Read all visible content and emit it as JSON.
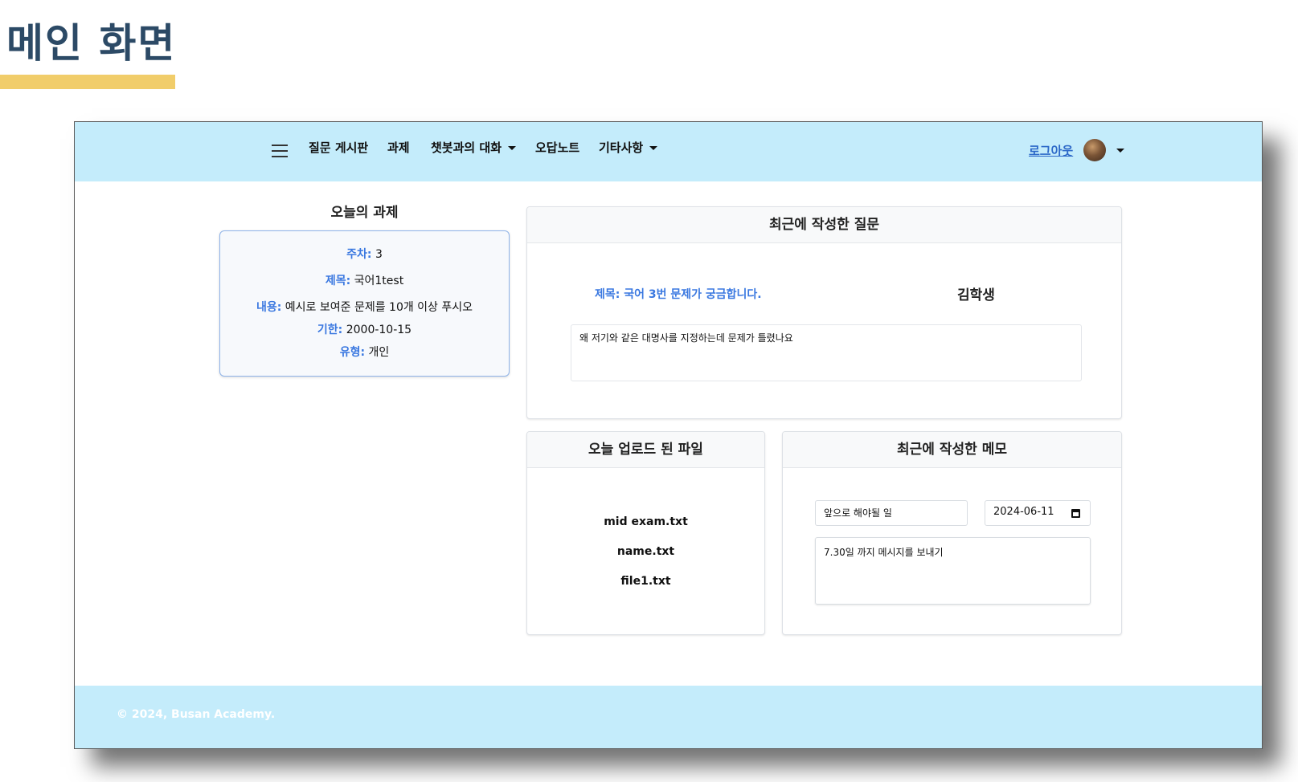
{
  "slide": {
    "title": "메인 화면"
  },
  "navbar": {
    "items": [
      {
        "label": "질문 게시판"
      },
      {
        "label": "과제"
      },
      {
        "label": "챗봇과의 대화"
      },
      {
        "label": "오답노트"
      },
      {
        "label": "기타사항"
      }
    ],
    "logout_label": "로그아웃"
  },
  "today_assignment": {
    "heading": "오늘의 과제",
    "week_label": "주차:",
    "week_value": "3",
    "title_label": "제목:",
    "title_value": "국어1test",
    "content_label": "내용:",
    "content_value": "예시로 보여준 문제를 10개 이상 푸시오",
    "deadline_label": "기한:",
    "deadline_value": "2000-10-15",
    "type_label": "유형:",
    "type_value": "개인"
  },
  "recent_question": {
    "heading": "최근에 작성한 질문",
    "title": "제목: 국어 3번 문제가 궁금합니다.",
    "author": "김학생",
    "body": "왜 저기와 같은 대명사를 지정하는데 문제가 틀렸나요"
  },
  "uploaded_files": {
    "heading": "오늘 업로드 된 파일",
    "files": [
      "mid exam.txt",
      "name.txt",
      "file1.txt"
    ]
  },
  "recent_memo": {
    "heading": "최근에 작성한 메모",
    "title_value": "앞으로 해야될 일",
    "date_value": "2024-06-11",
    "content": "7.30일 까지 메시지를 보내기"
  },
  "footer": {
    "text": "© 2024, Busan Academy."
  }
}
